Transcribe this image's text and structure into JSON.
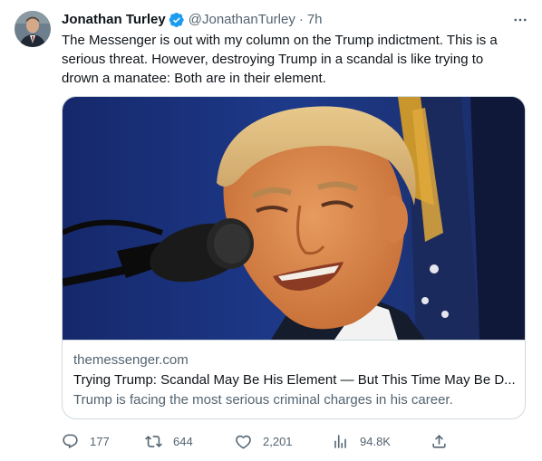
{
  "tweet": {
    "author_name": "Jonathan Turley",
    "handle": "@JonathanTurley",
    "separator": "·",
    "time": "7h",
    "text": "The Messenger is out with my column on the Trump indictment. This is a\nserious threat. However, destroying Trump in a scandal is like trying to\ndrown a manatee: Both are in their element."
  },
  "card": {
    "domain": "themessenger.com",
    "title": "Trying Trump: Scandal May Be His Element — But This Time May Be D...",
    "description": "Trump is facing the most serious criminal charges in his career."
  },
  "actions": {
    "replies": "177",
    "retweets": "644",
    "likes": "2,201",
    "views": "94.8K"
  },
  "colors": {
    "text_primary": "#0f1419",
    "text_secondary": "#536471",
    "border": "#cfd9de",
    "verified_badge": "#1d9bf0"
  },
  "icons": [
    "verified-badge-icon",
    "more-options-icon",
    "reply-icon",
    "retweet-icon",
    "like-icon",
    "views-icon",
    "share-icon"
  ]
}
